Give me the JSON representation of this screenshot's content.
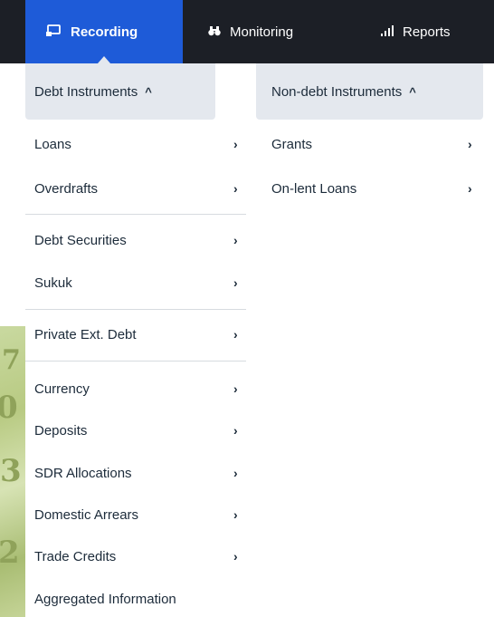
{
  "nav": {
    "tabs": [
      {
        "label": "Recording",
        "icon": "recording-icon",
        "active": true
      },
      {
        "label": "Monitoring",
        "icon": "binoculars-icon",
        "active": false
      },
      {
        "label": "Reports",
        "icon": "bar-chart-icon",
        "active": false
      }
    ]
  },
  "colors": {
    "active_tab": "#1e5bd8",
    "nav_bg": "#1c1f26",
    "group_header_bg": "#e4e8ee",
    "text": "#1c2b3a"
  },
  "left_menu": {
    "header": "Debt Instruments",
    "items": [
      {
        "label": "Loans",
        "has_submenu": true
      },
      {
        "label": "Overdrafts",
        "has_submenu": true
      },
      {
        "label": "Debt Securities",
        "has_submenu": true
      },
      {
        "label": "Sukuk",
        "has_submenu": true
      },
      {
        "label": "Private Ext. Debt",
        "has_submenu": true
      },
      {
        "label": "Currency",
        "has_submenu": true
      },
      {
        "label": "Deposits",
        "has_submenu": true
      },
      {
        "label": "SDR Allocations",
        "has_submenu": true
      },
      {
        "label": "Domestic Arrears",
        "has_submenu": true
      },
      {
        "label": "Trade Credits",
        "has_submenu": true
      },
      {
        "label": "Aggregated Information",
        "has_submenu": false
      }
    ]
  },
  "right_menu": {
    "header": "Non-debt Instruments",
    "items": [
      {
        "label": "Grants",
        "has_submenu": true
      },
      {
        "label": "On-lent Loans",
        "has_submenu": true
      }
    ]
  }
}
